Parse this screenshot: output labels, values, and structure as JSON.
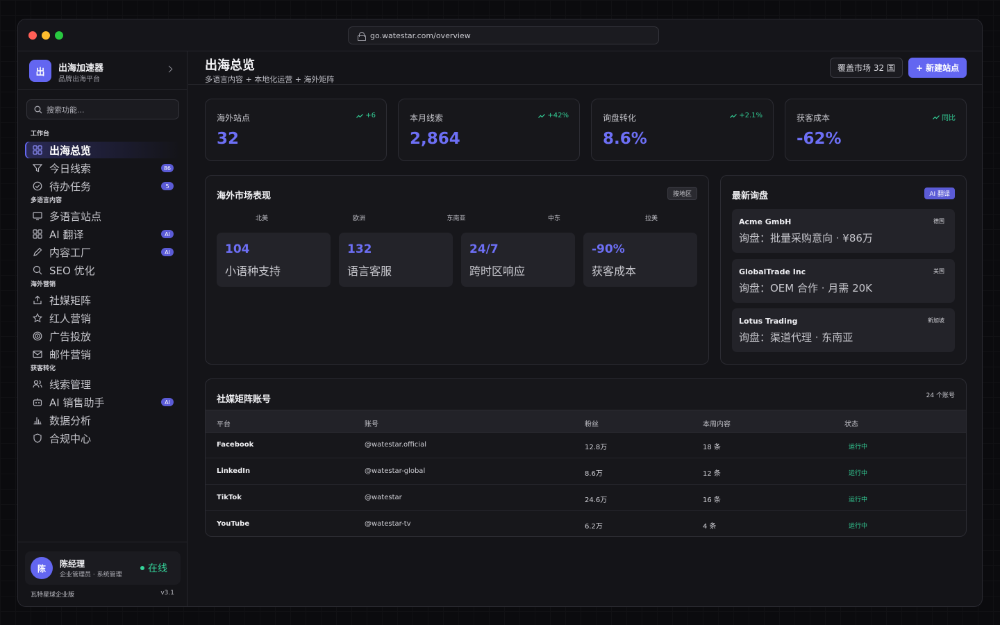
{
  "browser": {
    "url": "go.watestar.com/overview"
  },
  "brand": {
    "logo": "出",
    "name": "出海加速器",
    "subtitle": "品牌出海平台"
  },
  "search": {
    "placeholder": "搜索功能..."
  },
  "nav_groups": [
    {
      "title": "工作台",
      "items": [
        {
          "label": "出海总览",
          "icon": "grid-icon",
          "badge": "",
          "active": true
        },
        {
          "label": "今日线索",
          "icon": "funnel-icon",
          "badge": "86"
        },
        {
          "label": "待办任务",
          "icon": "check-circle-icon",
          "badge": "5"
        }
      ]
    },
    {
      "title": "多语言内容",
      "items": [
        {
          "label": "多语言站点",
          "icon": "monitor-icon",
          "badge": ""
        },
        {
          "label": "AI 翻译",
          "icon": "grid-icon",
          "badge": "AI"
        },
        {
          "label": "内容工厂",
          "icon": "pen-icon",
          "badge": "AI"
        },
        {
          "label": "SEO 优化",
          "icon": "search-icon",
          "badge": ""
        }
      ]
    },
    {
      "title": "海外营销",
      "items": [
        {
          "label": "社媒矩阵",
          "icon": "share-icon",
          "badge": ""
        },
        {
          "label": "红人营销",
          "icon": "star-icon",
          "badge": ""
        },
        {
          "label": "广告投放",
          "icon": "target-icon",
          "badge": ""
        },
        {
          "label": "邮件营销",
          "icon": "mail-icon",
          "badge": ""
        }
      ]
    },
    {
      "title": "获客转化",
      "items": [
        {
          "label": "线索管理",
          "icon": "users-icon",
          "badge": ""
        },
        {
          "label": "AI 销售助手",
          "icon": "robot-icon",
          "badge": "AI"
        },
        {
          "label": "数据分析",
          "icon": "bar-chart-icon",
          "badge": ""
        },
        {
          "label": "合规中心",
          "icon": "shield-icon",
          "badge": ""
        }
      ]
    }
  ],
  "user": {
    "avatar": "陈",
    "name": "陈经理",
    "role": "企业管理员 · 系统管理",
    "status": "在线"
  },
  "footer": {
    "edition": "瓦特星球企业版",
    "version": "v3.1"
  },
  "page": {
    "title": "出海总览",
    "subtitle": "多语言内容 + 本地化运营 + 海外矩阵",
    "coverage": "覆盖市场 32 国",
    "new_site": "+ 新建站点"
  },
  "stats": [
    {
      "label": "海外站点",
      "trend": "+6",
      "value": "32"
    },
    {
      "label": "本月线索",
      "trend": "+42%",
      "value": "2,864"
    },
    {
      "label": "询盘转化",
      "trend": "+2.1%",
      "value": "8.6%"
    },
    {
      "label": "获客成本",
      "trend": "同比",
      "value": "-62%"
    }
  ],
  "market": {
    "title": "海外市场表现",
    "filter": "按地区",
    "regions": [
      "北美",
      "欧洲",
      "东南亚",
      "中东",
      "拉美"
    ],
    "tiles": [
      {
        "value": "104",
        "label": "小语种支持"
      },
      {
        "value": "132",
        "label": "语言客服"
      },
      {
        "value": "24/7",
        "label": "跨时区响应"
      },
      {
        "value": "-90%",
        "label": "获客成本"
      }
    ]
  },
  "inquiries": {
    "title": "最新询盘",
    "tag": "AI 翻译",
    "items": [
      {
        "company": "Acme GmbH",
        "country": "德国",
        "message": "询盘：批量采购意向 · ¥86万"
      },
      {
        "company": "GlobalTrade Inc",
        "country": "美国",
        "message": "询盘：OEM 合作 · 月需 20K"
      },
      {
        "company": "Lotus Trading",
        "country": "新加坡",
        "message": "询盘：渠道代理 · 东南亚"
      }
    ]
  },
  "social": {
    "title": "社媒矩阵账号",
    "count": "24 个账号",
    "columns": [
      "平台",
      "账号",
      "粉丝",
      "本周内容",
      "状态"
    ],
    "rows": [
      {
        "platform": "Facebook",
        "account": "@watestar.official",
        "fans": "12.8万",
        "weekly": "18 条",
        "status": "运行中"
      },
      {
        "platform": "LinkedIn",
        "account": "@watestar-global",
        "fans": "8.6万",
        "weekly": "12 条",
        "status": "运行中"
      },
      {
        "platform": "TikTok",
        "account": "@watestar",
        "fans": "24.6万",
        "weekly": "16 条",
        "status": "运行中"
      },
      {
        "platform": "YouTube",
        "account": "@watestar-tv",
        "fans": "6.2万",
        "weekly": "4 条",
        "status": "运行中"
      }
    ]
  },
  "colors": {
    "accent": "#6366f1",
    "success": "#34d399",
    "background": "#141418"
  }
}
